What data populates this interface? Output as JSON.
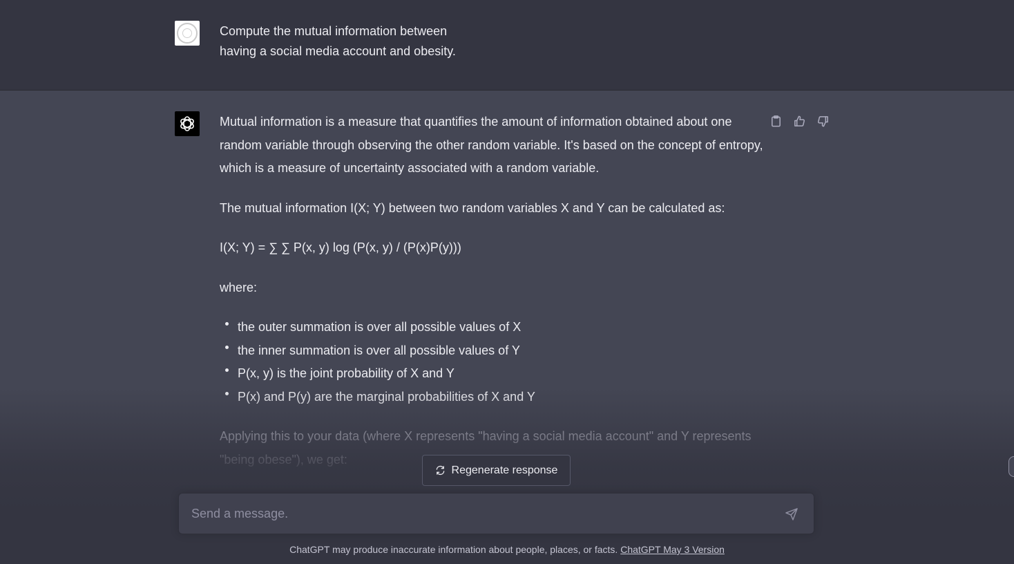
{
  "user_message": {
    "line1": "Compute the mutual information between",
    "line2": "having a social media account and obesity."
  },
  "assistant_message": {
    "para1": "Mutual information is a measure that quantifies the amount of information obtained about one random variable through observing the other random variable. It's based on the concept of entropy, which is a measure of uncertainty associated with a random variable.",
    "para2": "The mutual information I(X; Y) between two random variables X and Y can be calculated as:",
    "formula": "I(X; Y) = ∑ ∑ P(x, y) log (P(x, y) / (P(x)P(y)))",
    "where": "where:",
    "bullets": [
      "the outer summation is over all possible values of X",
      "the inner summation is over all possible values of Y",
      "P(x, y) is the joint probability of X and Y",
      "P(x) and P(y) are the marginal probabilities of X and Y"
    ],
    "para_last": "Applying this to your data (where X represents \"having a social media account\" and Y represents \"being obese\"), we get:"
  },
  "actions": {
    "copy_icon": "clipboard-icon",
    "thumbs_up_icon": "thumbs-up-icon",
    "thumbs_down_icon": "thumbs-down-icon"
  },
  "regenerate": {
    "label": "Regenerate response",
    "icon": "refresh-icon"
  },
  "composer": {
    "placeholder": "Send a message.",
    "value": "",
    "send_icon": "paper-plane-icon"
  },
  "footer": {
    "text": "ChatGPT may produce inaccurate information about people, places, or facts. ",
    "link": "ChatGPT May 3 Version"
  },
  "colors": {
    "user_bg": "#343541",
    "assistant_bg": "#444654",
    "text": "#ececf1",
    "muted": "#8e8ea0"
  }
}
